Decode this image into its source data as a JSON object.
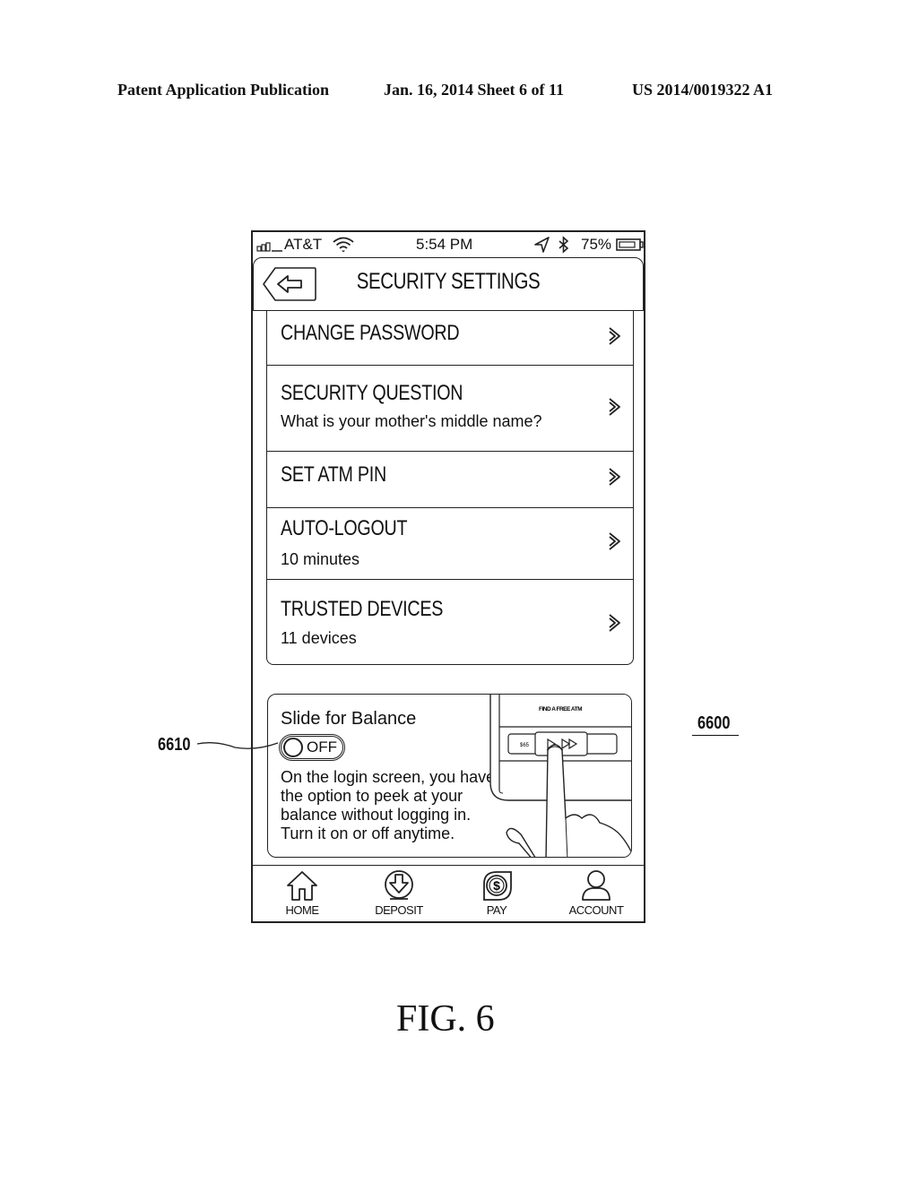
{
  "patent_header": {
    "left": "Patent Application Publication",
    "middle": "Jan. 16, 2014   Sheet 6 of 11",
    "right": "US 2014/0019322 A1"
  },
  "status_bar": {
    "carrier": "AT&T",
    "time": "5:54 PM",
    "battery": "75%",
    "icons": [
      "signal-icon",
      "wifi-icon",
      "location-arrow-icon",
      "bluetooth-icon",
      "battery-icon"
    ]
  },
  "nav": {
    "back_icon": "back-arrow-icon",
    "title": "SECURITY SETTINGS"
  },
  "settings": [
    {
      "title": "CHANGE PASSWORD",
      "subtitle": null
    },
    {
      "title": "SECURITY QUESTION",
      "subtitle": "What is your mother's middle name?"
    },
    {
      "title": "SET ATM PIN",
      "subtitle": null
    },
    {
      "title": "AUTO-LOGOUT",
      "subtitle": "10 minutes"
    },
    {
      "title": "TRUSTED DEVICES",
      "subtitle": "11 devices"
    }
  ],
  "balance_card": {
    "title": "Slide for Balance",
    "toggle_state": "OFF",
    "description": "On the login screen, you have the option to peek at your balance without logging in. Turn it on or off anytime.",
    "illustration": {
      "screen_label": "FIND A FREE ATM",
      "slider_amount": "$65"
    }
  },
  "tab_bar": [
    {
      "label": "HOME",
      "icon": "home-icon"
    },
    {
      "label": "DEPOSIT",
      "icon": "deposit-icon"
    },
    {
      "label": "PAY",
      "icon": "pay-icon"
    },
    {
      "label": "ACCOUNT",
      "icon": "account-icon"
    }
  ],
  "reference_numerals": {
    "screen": "6600",
    "toggle": "6610"
  },
  "figure_label": "FIG. 6"
}
